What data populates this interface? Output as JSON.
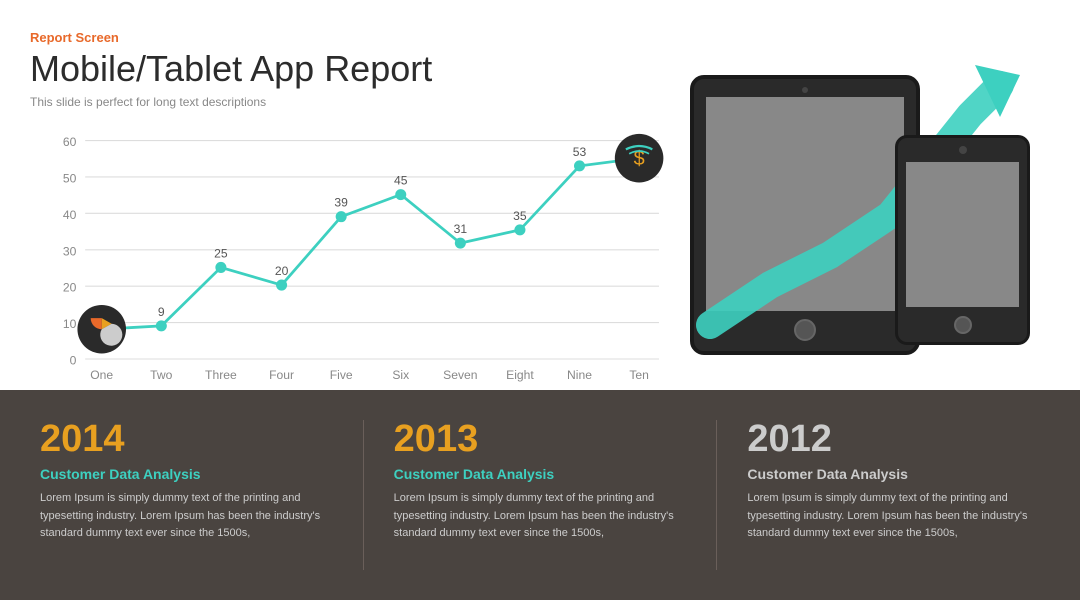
{
  "header": {
    "report_label": "Report Screen",
    "main_title": "Mobile/Tablet App Report",
    "subtitle": "This slide is perfect for long text descriptions"
  },
  "chart": {
    "x_labels": [
      "One",
      "Two",
      "Three",
      "Four",
      "Five",
      "Six",
      "Seven",
      "Eight",
      "Nine",
      "Ten"
    ],
    "y_labels": [
      "0",
      "10",
      "20",
      "30",
      "40",
      "50",
      "60"
    ],
    "data_points": [
      8,
      9,
      25,
      20,
      39,
      45,
      31,
      35,
      53,
      55
    ],
    "line_color": "#3dd0c0",
    "grid_color": "#ddd"
  },
  "bottom": {
    "columns": [
      {
        "year": "2014",
        "heading": "Customer Data Analysis",
        "body": "Lorem Ipsum is simply dummy text of the printing and typesetting industry. Lorem Ipsum has been the industry's standard dummy text ever since the 1500s,"
      },
      {
        "year": "2013",
        "heading": "Customer Data Analysis",
        "body": "Lorem Ipsum is simply dummy text of the printing and typesetting industry. Lorem Ipsum has been the industry's standard dummy text ever since the 1500s,"
      },
      {
        "year": "2012",
        "heading": "Customer Data Analysis",
        "body": "Lorem Ipsum is simply dummy text of the printing and typesetting industry. Lorem Ipsum has been the industry's standard dummy text ever since the 1500s,"
      }
    ]
  }
}
